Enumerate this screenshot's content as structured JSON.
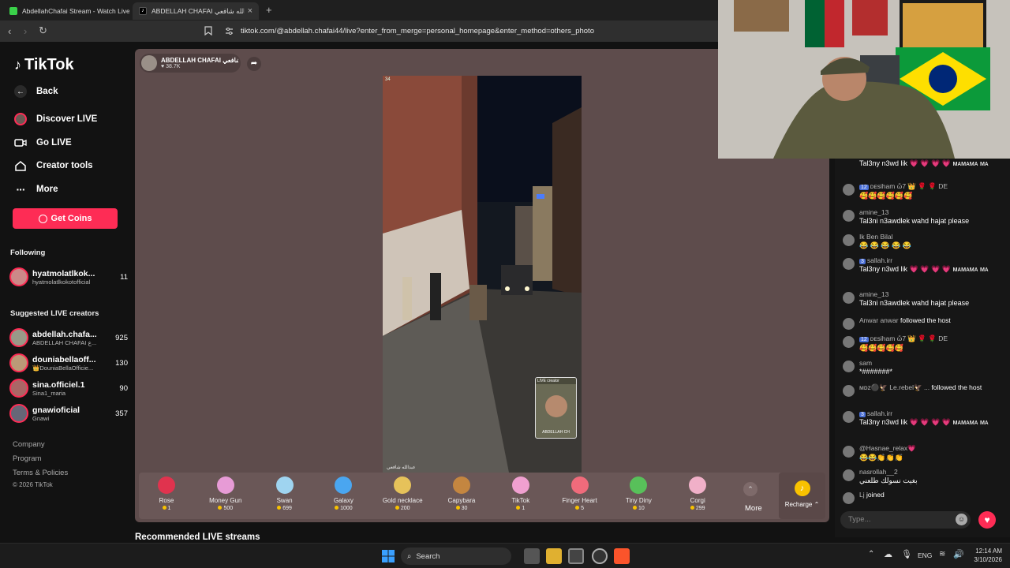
{
  "browser": {
    "tabs": [
      {
        "title": "AbdellahChafai Stream - Watch Live",
        "active": false
      },
      {
        "title": "ABDELLAH CHAFAI عبدالله شافعي",
        "active": true
      }
    ],
    "new_tab": "+",
    "close": "×",
    "url": "tiktok.com/@abdellah.chafai44/live?enter_from_merge=personal_homepage&enter_method=others_photo"
  },
  "sidebar": {
    "logo": "TikTok",
    "nav": [
      {
        "label": "Back",
        "icon": "arrow-left-icon"
      },
      {
        "label": "Discover LIVE",
        "icon": "live-avatar-icon"
      },
      {
        "label": "Go LIVE",
        "icon": "video-camera-icon"
      },
      {
        "label": "Creator tools",
        "icon": "home-icon"
      },
      {
        "label": "More",
        "icon": "dots-icon"
      }
    ],
    "get_coins": "Get Coins",
    "following_heading": "Following",
    "following": [
      {
        "name": "hyatmolatlkok...",
        "sub": "hyatmolatlkokotofficial",
        "count": "11"
      }
    ],
    "suggested_heading": "Suggested LIVE creators",
    "suggested": [
      {
        "name": "abdellah.chafa...",
        "sub": "ABDELLAH CHAFAI ع...",
        "count": "925"
      },
      {
        "name": "douniabellaoff...",
        "sub": "👑DouniaBellaOfficie...",
        "count": "130"
      },
      {
        "name": "sina.officiel.1",
        "sub": "Sina1_maria",
        "count": "90"
      },
      {
        "name": "gnawioficial",
        "sub": "Gnawi",
        "count": "357"
      }
    ],
    "footer": [
      "Company",
      "Program",
      "Terms & Policies",
      "© 2026 TikTok"
    ]
  },
  "stream": {
    "host_name": "ABDELLAH CHAFAI عبدالله شافعي",
    "likes": "38.7K",
    "viewer_badge": "34",
    "pip_label": "ABDELLAH CH",
    "pip_top": "LIVE creator",
    "caption": "عبدالله شافعي"
  },
  "gifts": [
    {
      "name": "Rose",
      "price": "1",
      "color": "#e0334e"
    },
    {
      "name": "Money Gun",
      "price": "500",
      "color": "#e79bd6"
    },
    {
      "name": "Swan",
      "price": "699",
      "color": "#9fd4f0"
    },
    {
      "name": "Galaxy",
      "price": "1000",
      "color": "#4aa6f0"
    },
    {
      "name": "Gold necklace",
      "price": "200",
      "color": "#e6c25a"
    },
    {
      "name": "Capybara",
      "price": "30",
      "color": "#c48640"
    },
    {
      "name": "TikTok",
      "price": "1",
      "color": "#f0a0d0"
    },
    {
      "name": "Finger Heart",
      "price": "5",
      "color": "#f06b7b"
    },
    {
      "name": "Tiny Diny",
      "price": "10",
      "color": "#58c05a"
    },
    {
      "name": "Corgi",
      "price": "299",
      "color": "#f0b0c8"
    }
  ],
  "gifts_more": "More",
  "recharge": "Recharge",
  "recommended": "Recommended LIVE streams",
  "chat": {
    "messages": [
      {
        "name": "",
        "text": "Tal3ny n3wd lik 💗 💗 💗 💗 ᴍᴀᴍᴀᴍᴀ ᴍᴀ",
        "badge": ""
      },
      {
        "name": "ᴅᴇsiham ὤ7 👑 🌹 🌹 DE",
        "text": "🥰🥰🥰🥰🥰🥰",
        "badge": "12"
      },
      {
        "name": "amine_13",
        "text": "Tal3ni n3awdlek wahd hajat please",
        "badge": ""
      },
      {
        "name": "Ik Ben Bilal",
        "text": "😂 😂 😂 😂 😂",
        "badge": ""
      },
      {
        "name": "sallah.irr",
        "text": "Tal3ny n3wd lik 💗 💗 💗 💗 ᴍᴀᴍᴀᴍᴀ ᴍᴀ",
        "badge": "3"
      },
      {
        "name": "amine_13",
        "text": "Tal3ni n3awdlek wahd hajat please",
        "badge": ""
      },
      {
        "name": "Anwar anwar",
        "text": "followed the host",
        "badge": ""
      },
      {
        "name": "ᴅᴇsiham ὤ7 👑 🌹 🌹 DE",
        "text": "🥰🥰🥰🥰🥰",
        "badge": "12"
      },
      {
        "name": "sam",
        "text": "*#######*",
        "badge": ""
      },
      {
        "name": "ᴍᴅᴢ⚫🦅 Le.rebel🦅 ...",
        "text": "followed the host",
        "badge": ""
      },
      {
        "name": "sallah.irr",
        "text": "Tal3ny n3wd lik 💗 💗 💗 💗 ᴍᴀᴍᴀᴍᴀ ᴍᴀ",
        "badge": "3"
      },
      {
        "name": "@Hasnae_relax💗",
        "text": "😂😂👏👏👏",
        "badge": ""
      },
      {
        "name": "nasrollah__2",
        "text": "بغيت نسولك طلعني",
        "badge": ""
      },
      {
        "name": "Lj",
        "text": "joined",
        "badge": ""
      }
    ],
    "placeholder": "Type..."
  },
  "taskbar": {
    "search": "Search",
    "lang": "ENG",
    "time": "12:14 AM",
    "date": "3/10/2026"
  }
}
